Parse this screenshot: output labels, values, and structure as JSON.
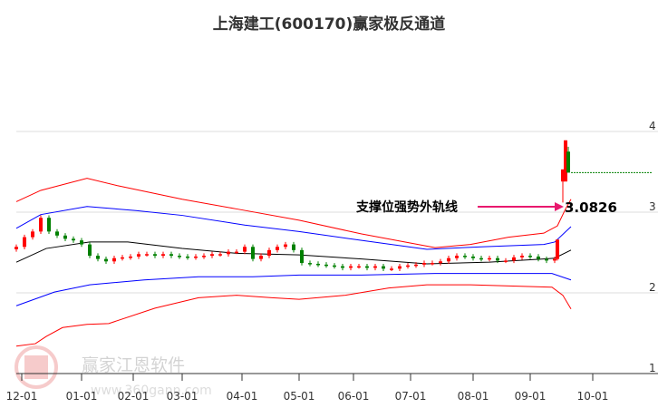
{
  "chart_data": {
    "type": "candlestick-channel",
    "title": "上海建工(600170)赢家极反通道",
    "ylim": [
      1,
      4
    ],
    "yticks": [
      "4",
      "3",
      "2",
      "1"
    ],
    "ytick_values": [
      4,
      3,
      2,
      1
    ],
    "xticks": [
      "12-01",
      "01-01",
      "02-01",
      "03-01",
      "04-01",
      "05-01",
      "06-01",
      "07-01",
      "08-01",
      "09-01",
      "10-01"
    ],
    "xtick_index": [
      2,
      24,
      43,
      61,
      83,
      104,
      124,
      145,
      168,
      189,
      212
    ],
    "x_range": [
      0,
      236
    ],
    "grid": true,
    "closes_step": 3,
    "closes": [
      2.57,
      2.69,
      2.76,
      2.93,
      2.76,
      2.71,
      2.67,
      2.65,
      2.6,
      2.46,
      2.42,
      2.39,
      2.43,
      2.44,
      2.45,
      2.48,
      2.48,
      2.46,
      2.48,
      2.46,
      2.45,
      2.44,
      2.45,
      2.46,
      2.48,
      2.48,
      2.51,
      2.51,
      2.57,
      2.42,
      2.46,
      2.53,
      2.57,
      2.6,
      2.53,
      2.37,
      2.36,
      2.35,
      2.34,
      2.33,
      2.31,
      2.33,
      2.33,
      2.31,
      2.33,
      2.3,
      2.3,
      2.33,
      2.34,
      2.35,
      2.37,
      2.37,
      2.39,
      2.43,
      2.46,
      2.45,
      2.43,
      2.42,
      2.43,
      2.4,
      2.4,
      2.44,
      2.46,
      2.45,
      2.42,
      2.4,
      2.42
    ],
    "final_candles": [
      {
        "i": 199,
        "o": 2.42,
        "h": 2.66,
        "l": 2.4,
        "c": 2.66
      },
      {
        "i": 201,
        "o": 3.38,
        "h": 3.53,
        "l": 3.12,
        "c": 3.53
      },
      {
        "i": 202,
        "o": 3.38,
        "h": 3.89,
        "l": 3.38,
        "c": 3.89
      },
      {
        "i": 203,
        "o": 3.75,
        "h": 3.81,
        "l": 3.49,
        "c": 3.49
      }
    ],
    "last_price_line": 3.49,
    "bands": [
      {
        "name": "upper-outer",
        "color": "#ff0000",
        "points": [
          [
            0,
            3.13
          ],
          [
            9,
            3.27
          ],
          [
            26,
            3.42
          ],
          [
            37,
            3.33
          ],
          [
            61,
            3.16
          ],
          [
            81,
            3.04
          ],
          [
            104,
            2.9
          ],
          [
            127,
            2.73
          ],
          [
            154,
            2.56
          ],
          [
            167,
            2.6
          ],
          [
            181,
            2.69
          ],
          [
            194,
            2.74
          ],
          [
            199,
            2.83
          ],
          [
            202,
            3.04
          ],
          [
            204,
            3.16
          ]
        ]
      },
      {
        "name": "upper-inner",
        "color": "#0000ff",
        "points": [
          [
            0,
            2.8
          ],
          [
            9,
            2.97
          ],
          [
            26,
            3.07
          ],
          [
            44,
            3.02
          ],
          [
            61,
            2.96
          ],
          [
            84,
            2.84
          ],
          [
            104,
            2.76
          ],
          [
            127,
            2.65
          ],
          [
            151,
            2.54
          ],
          [
            171,
            2.57
          ],
          [
            194,
            2.6
          ],
          [
            198,
            2.63
          ],
          [
            204,
            2.82
          ]
        ]
      },
      {
        "name": "middle",
        "color": "#000000",
        "points": [
          [
            0,
            2.38
          ],
          [
            11,
            2.55
          ],
          [
            27,
            2.63
          ],
          [
            41,
            2.63
          ],
          [
            61,
            2.55
          ],
          [
            81,
            2.49
          ],
          [
            104,
            2.47
          ],
          [
            127,
            2.42
          ],
          [
            151,
            2.36
          ],
          [
            174,
            2.38
          ],
          [
            194,
            2.42
          ],
          [
            198,
            2.43
          ],
          [
            204,
            2.53
          ]
        ]
      },
      {
        "name": "lower-inner",
        "color": "#0000ff",
        "points": [
          [
            0,
            1.84
          ],
          [
            14,
            2.01
          ],
          [
            27,
            2.1
          ],
          [
            47,
            2.16
          ],
          [
            67,
            2.2
          ],
          [
            87,
            2.2
          ],
          [
            104,
            2.22
          ],
          [
            127,
            2.22
          ],
          [
            154,
            2.24
          ],
          [
            181,
            2.24
          ],
          [
            197,
            2.24
          ],
          [
            204,
            2.16
          ]
        ]
      },
      {
        "name": "lower-outer",
        "color": "#ff0000",
        "points": [
          [
            0,
            1.34
          ],
          [
            7,
            1.37
          ],
          [
            11,
            1.46
          ],
          [
            17,
            1.57
          ],
          [
            26,
            1.61
          ],
          [
            34,
            1.62
          ],
          [
            51,
            1.81
          ],
          [
            67,
            1.94
          ],
          [
            81,
            1.97
          ],
          [
            94,
            1.94
          ],
          [
            104,
            1.92
          ],
          [
            121,
            1.97
          ],
          [
            137,
            2.06
          ],
          [
            151,
            2.1
          ],
          [
            167,
            2.1
          ],
          [
            187,
            2.08
          ],
          [
            197,
            2.07
          ],
          [
            201,
            1.97
          ],
          [
            204,
            1.8
          ]
        ]
      }
    ],
    "annotation": {
      "label": "支撑位强势外轨线",
      "value": "3.0826",
      "price": 3.0826,
      "color": "#e8196e"
    },
    "colors": {
      "up": "#ff0000",
      "down": "#008000"
    }
  },
  "watermark": {
    "logo_chars": [
      "江",
      "赢",
      "恩",
      "家"
    ],
    "name": "赢家江恩软件",
    "url": "www.360gann.com"
  }
}
